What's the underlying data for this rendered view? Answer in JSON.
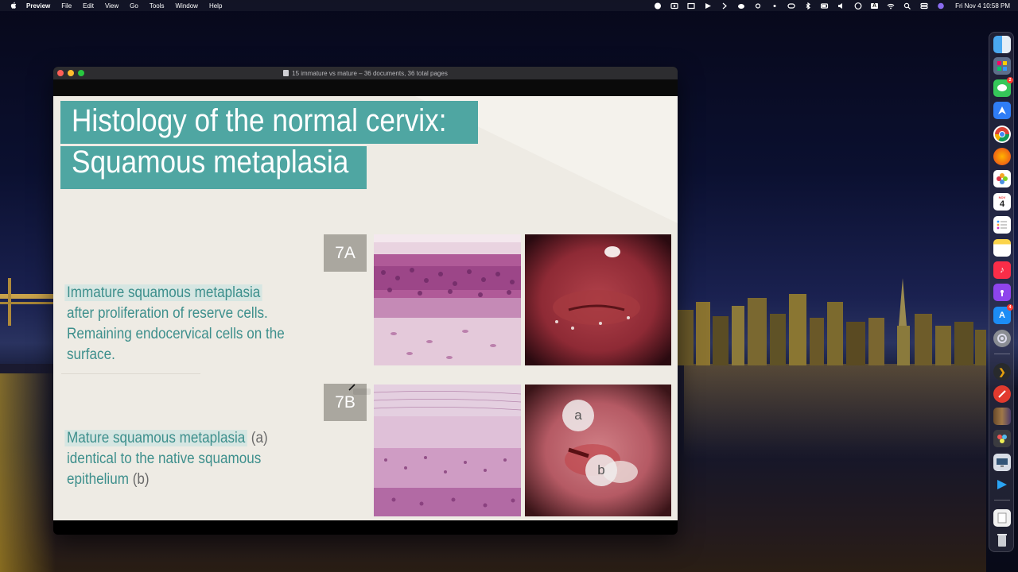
{
  "menubar": {
    "app_name": "Preview",
    "items": [
      "File",
      "Edit",
      "View",
      "Go",
      "Tools",
      "Window",
      "Help"
    ],
    "clock": "Fri Nov 4  10:58 PM",
    "status_icons": [
      "skype-icon",
      "screen-record-icon",
      "display-icon",
      "play-icon",
      "chevron-icon",
      "cloud-icon",
      "brightness-icon",
      "notification-icon",
      "toggle-icon",
      "bluetooth-icon",
      "battery-icon",
      "volume-icon",
      "play-circle-icon",
      "input-source-icon",
      "wifi-icon",
      "search-icon",
      "control-center-icon",
      "siri-icon"
    ],
    "input_source_label": "A"
  },
  "window": {
    "title": "15 immature vs mature – 36 documents, 36 total pages"
  },
  "slide": {
    "title_line1": "Histology of the normal cervix:",
    "title_line2": "Squamous metaplasia",
    "section_a": {
      "badge": "7A",
      "heading": "Immature squamous metaplasia",
      "line2": "after proliferation of reserve cells.",
      "line3": "Remaining endocervical cells on the",
      "line4": "surface."
    },
    "section_b": {
      "badge": "7B",
      "heading": "Mature squamous metaplasia",
      "heading_suffix": " (a)",
      "line2": "identical to the native squamous",
      "line3": "epithelium",
      "line3_suffix": " (b)",
      "marker_a": "a",
      "marker_b": "b"
    }
  },
  "dock": {
    "apps": [
      "finder-icon",
      "launchpad-icon",
      "messages-icon",
      "maps-icon",
      "chrome-icon",
      "firefox-icon",
      "photos-icon",
      "calendar-icon",
      "reminders-icon",
      "notes-icon",
      "music-icon",
      "podcasts-icon",
      "app-store-icon",
      "system-preferences-icon",
      "plex-icon",
      "red-app-icon",
      "preview-icon",
      "photo-booth-icon",
      "screen-sharing-icon",
      "action-icon",
      "documents-icon",
      "trash-icon"
    ],
    "calendar_month": "NOV",
    "calendar_day": "4",
    "messages_badge": "2",
    "appstore_badge": "4"
  },
  "colors": {
    "accent_teal": "#4fa6a2",
    "text_teal": "#3d8f8c",
    "slide_bg": "#eeebe4",
    "badge_gray": "#aaa79f"
  }
}
